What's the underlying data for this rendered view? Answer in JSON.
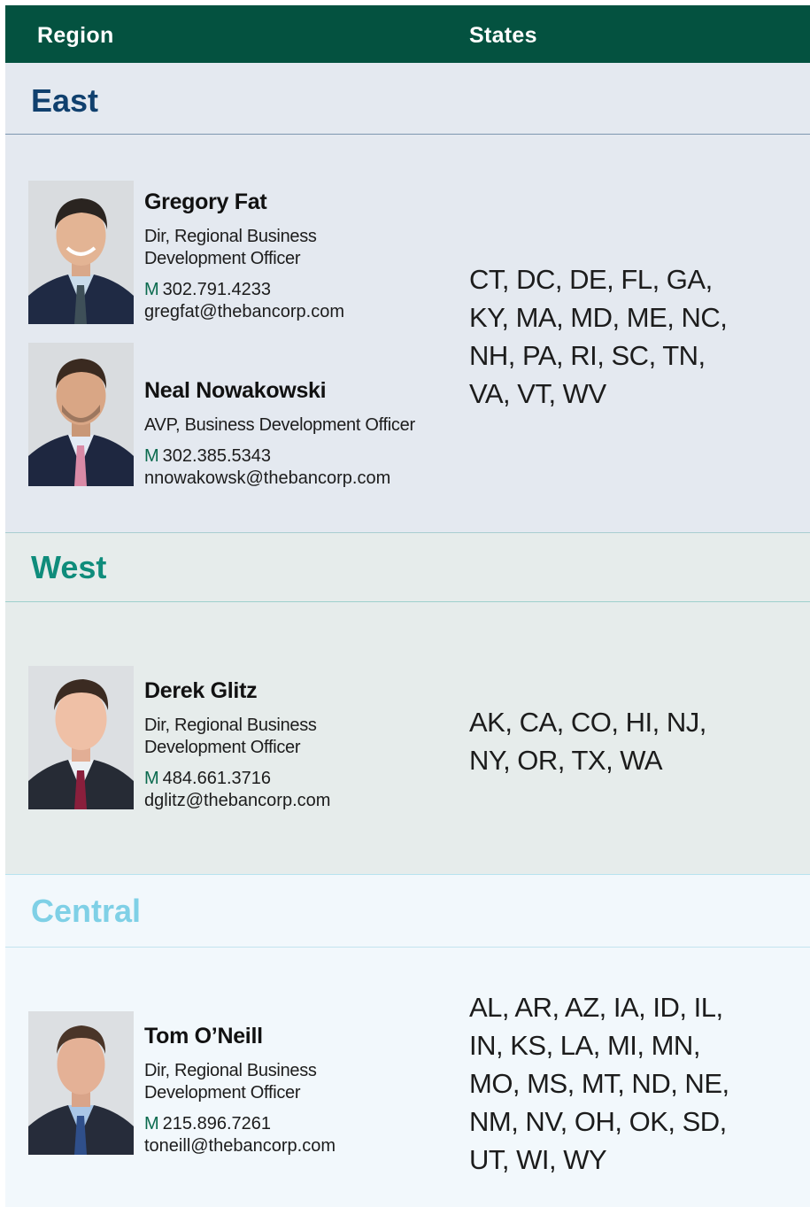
{
  "header": {
    "region_label": "Region",
    "states_label": "States"
  },
  "regions": [
    {
      "name": "East",
      "color": "#10406e",
      "people": [
        {
          "name": "Gregory Fat",
          "title_line1": "Dir, Regional Business",
          "title_line2": "Development Officer",
          "phone_prefix": "M",
          "phone": "302.791.4233",
          "email": "gregfat@thebancorp.com",
          "tie": "#3e4f58"
        },
        {
          "name": "Neal Nowakowski",
          "title_line1": "AVP, Business Development Officer",
          "title_line2": "",
          "phone_prefix": "M",
          "phone": "302.385.5343",
          "email": "nnowakowsk@thebancorp.com",
          "tie": "#d98aa6"
        }
      ],
      "states_lines": [
        "CT, DC, DE, FL, GA,",
        "KY, MA, MD, ME, NC,",
        "NH, PA, RI, SC, TN,",
        "VA, VT, WV"
      ]
    },
    {
      "name": "West",
      "color": "#0f8c7b",
      "people": [
        {
          "name": "Derek Glitz",
          "title_line1": "Dir, Regional Business",
          "title_line2": "Development Officer",
          "phone_prefix": "M",
          "phone": "484.661.3716",
          "email": "dglitz@thebancorp.com",
          "tie": "#8a1f3c"
        }
      ],
      "states_lines": [
        "AK, CA, CO, HI, NJ,",
        "NY, OR, TX, WA"
      ]
    },
    {
      "name": "Central",
      "color": "#7fd0e6",
      "people": [
        {
          "name": "Tom O’Neill",
          "title_line1": "Dir, Regional Business",
          "title_line2": "Development Officer",
          "phone_prefix": "M",
          "phone": "215.896.7261",
          "email": "toneill@thebancorp.com",
          "tie": "#2f4f8a"
        }
      ],
      "states_lines": [
        "AL, AR, AZ, IA, ID, IL,",
        "IN, KS, LA, MI, MN,",
        "MO, MS, MT, ND, NE,",
        "NM, NV, OH, OK, SD,",
        "UT, WI, WY"
      ]
    }
  ],
  "colors": {
    "header_bg": "#045240",
    "east_bg": "#e4e9f0",
    "west_bg": "#e6eceb",
    "central_bg": "#f2f8fc"
  }
}
